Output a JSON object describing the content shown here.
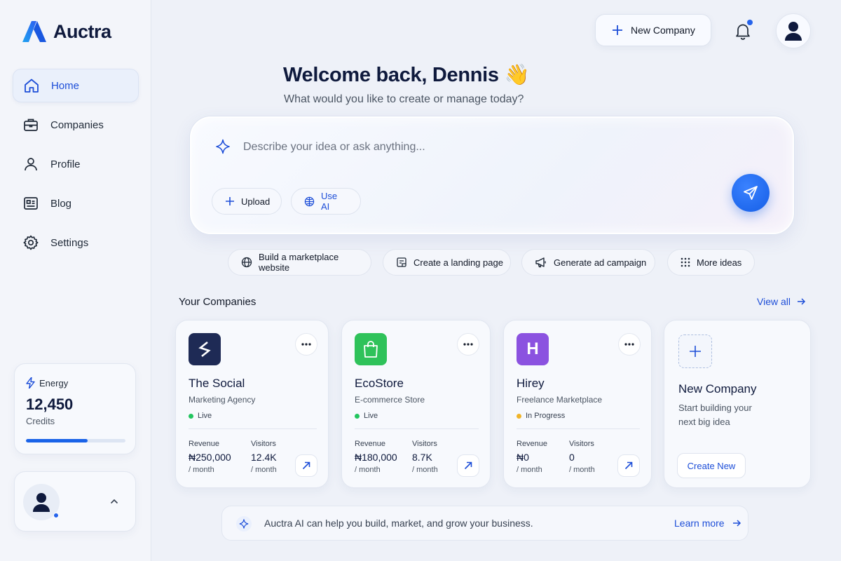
{
  "app": {
    "name": "Auctra"
  },
  "sidebar": {
    "items": [
      {
        "label": "Home",
        "icon": "home-icon",
        "active": true
      },
      {
        "label": "Companies",
        "icon": "briefcase-icon"
      },
      {
        "label": "Profile",
        "icon": "user-icon"
      },
      {
        "label": "Blog",
        "icon": "article-icon"
      },
      {
        "label": "Settings",
        "icon": "gear-icon"
      }
    ],
    "energy": {
      "label": "Energy",
      "value": "12,450",
      "unit": "Credits",
      "fill_fraction": 0.62
    }
  },
  "header": {
    "new_company_label": "New Company"
  },
  "welcome": {
    "title": "Welcome back, Dennis 👋",
    "subtitle": "What would you like to create or manage today?"
  },
  "prompt": {
    "placeholder": "Describe your idea or ask anything...",
    "upload_label": "Upload",
    "ai_label": "Use AI"
  },
  "suggestions": [
    {
      "label": "Build a marketplace website",
      "icon": "globe-icon"
    },
    {
      "label": "Create a landing page",
      "icon": "page-icon"
    },
    {
      "label": "Generate ad campaign",
      "icon": "megaphone-icon"
    },
    {
      "label": "More ideas",
      "icon": "grid-dots-icon"
    }
  ],
  "companies": {
    "title": "Your Companies",
    "view_all": "View all",
    "items": [
      {
        "name": "The Social",
        "type": "Marketing Agency",
        "status": "Live",
        "status_color": "#22c55e",
        "logo_color": "#1e2a55",
        "revenue_label": "Revenue",
        "revenue": "₦250,000",
        "revenue_unit": "/ month",
        "visitors_label": "Visitors",
        "visitors": "12.4K",
        "visitors_unit": "/ month"
      },
      {
        "name": "EcoStore",
        "type": "E-commerce Store",
        "status": "Live",
        "status_color": "#22c55e",
        "logo_color": "#2fc25a",
        "revenue_label": "Revenue",
        "revenue": "₦180,000",
        "revenue_unit": "/ month",
        "visitors_label": "Visitors",
        "visitors": "8.7K",
        "visitors_unit": "/ month"
      },
      {
        "name": "Hirey",
        "type": "Freelance Marketplace",
        "status": "In Progress",
        "status_color": "#f0b429",
        "logo_color": "#8b52e0",
        "logo_letter": "H",
        "revenue_label": "Revenue",
        "revenue": "₦0",
        "revenue_unit": "/ month",
        "visitors_label": "Visitors",
        "visitors": "0",
        "visitors_unit": "/ month"
      }
    ],
    "new_card": {
      "title": "New Company",
      "desc": "Start building your next big idea",
      "button": "Create New"
    }
  },
  "banner": {
    "text": "Auctra AI can help you build, market, and grow your business.",
    "link": "Learn more"
  }
}
